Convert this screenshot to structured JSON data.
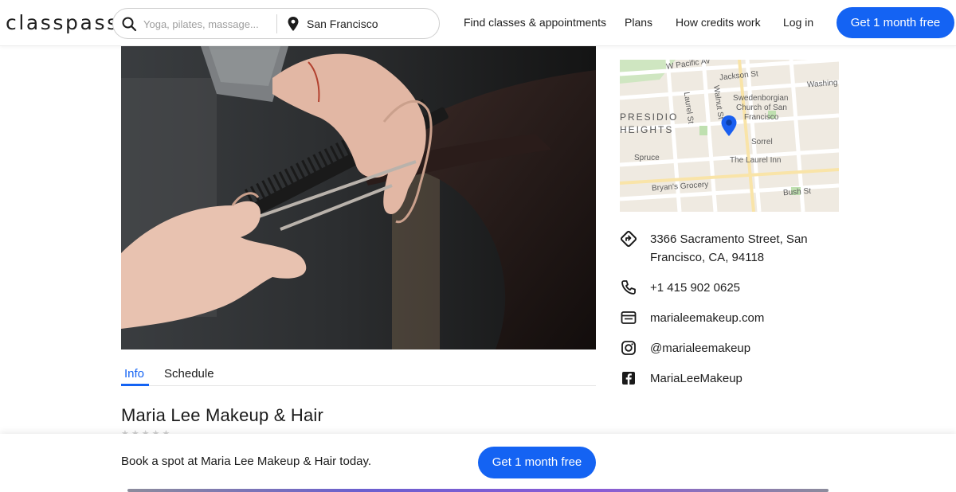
{
  "header": {
    "logo": "classpass",
    "search_placeholder": "Yoga, pilates, massage...",
    "location": "San Francisco",
    "nav": [
      "Find classes & appointments",
      "Plans",
      "How credits work",
      "Log in"
    ],
    "cta": "Get 1 month free",
    "accent_color": "#1463f3"
  },
  "tabs": [
    "Info",
    "Schedule"
  ],
  "studio": {
    "name": "Maria Lee Makeup & Hair",
    "rating_stars": "★★★★★"
  },
  "map": {
    "labels": [
      "W Pacific Av",
      "Jackson St",
      "Washing",
      "Laurel St",
      "Walnut St",
      "Swedenborgian",
      "Church of San",
      "Francisco",
      "PRESIDIO",
      "HEIGHTS",
      "Sorrel",
      "Spruce",
      "The Laurel Inn",
      "Bryan's Grocery",
      "Bush St"
    ],
    "pin_color": "#1a5ff0"
  },
  "contact": {
    "address_line1": "3366 Sacramento Street, San",
    "address_line2": "Francisco, CA, 94118",
    "phone": "+1 415 902 0625",
    "website": "marialeemakeup.com",
    "instagram": "@marialeemakeup",
    "facebook": "MariaLeeMakeup"
  },
  "bottom_bar": {
    "text": "Book a spot at Maria Lee Makeup & Hair today.",
    "cta": "Get 1 month free"
  }
}
